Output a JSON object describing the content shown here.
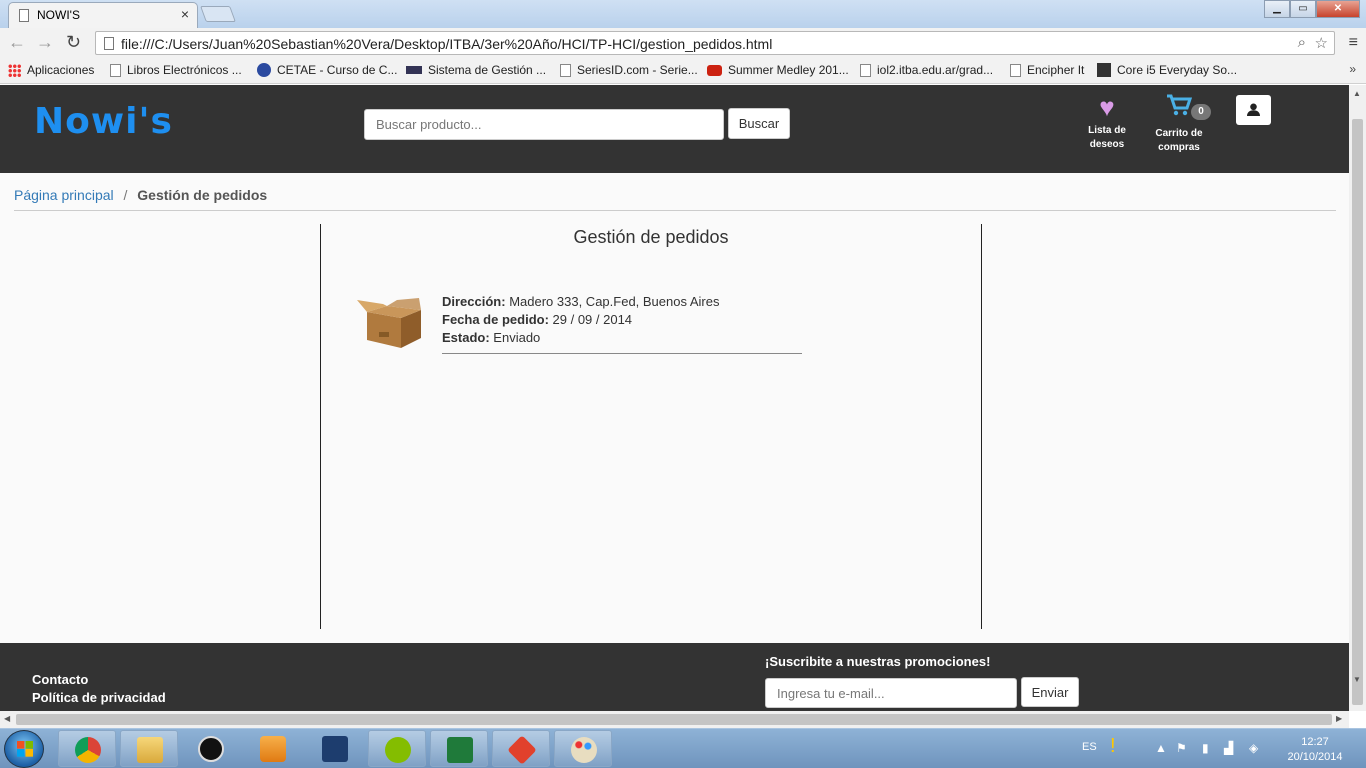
{
  "browser": {
    "tab_title": "NOWI'S",
    "tab_close": "×",
    "url": "file:///C:/Users/Juan%20Sebastian%20Vera/Desktop/ITBA/3er%20Año/HCI/TP-HCI/gestion_pedidos.html",
    "bookmarks": [
      {
        "label": "Aplicaciones",
        "icon": "apps-icon"
      },
      {
        "label": "Libros Electrónicos ...",
        "icon": "page-icon"
      },
      {
        "label": "CETAE - Curso de C...",
        "icon": "cetae-icon"
      },
      {
        "label": "Sistema de Gestión ...",
        "icon": "sistema-icon"
      },
      {
        "label": "SeriesID.com - Serie...",
        "icon": "page-icon"
      },
      {
        "label": "Summer Medley 201...",
        "icon": "youtube-icon"
      },
      {
        "label": "iol2.itba.edu.ar/grad...",
        "icon": "page-icon"
      },
      {
        "label": "Encipher It",
        "icon": "page-icon"
      },
      {
        "label": "Core i5 Everyday So...",
        "icon": "core-icon"
      }
    ],
    "bookmarks_more": "»"
  },
  "site": {
    "logo": "Nowi's",
    "search_placeholder": "Buscar producto...",
    "search_button": "Buscar",
    "wishlist_label": "Lista de deseos",
    "cart_label": "Carrito de compras",
    "cart_count": "0",
    "colors": {
      "header_bg": "#333333",
      "logo": "#1e8ff0",
      "heart": "#d99be6",
      "cart": "#4ab0e6",
      "link": "#337ab7"
    }
  },
  "breadcrumb": {
    "home": "Página principal",
    "separator": "/",
    "current": "Gestión de pedidos"
  },
  "main": {
    "title": "Gestión de pedidos",
    "orders": [
      {
        "direccion_label": "Dirección:",
        "direccion": "Madero 333, Cap.Fed, Buenos Aires",
        "fecha_label": "Fecha de pedido:",
        "fecha": "29 / 09 / 2014",
        "estado_label": "Estado:",
        "estado": "Enviado"
      }
    ]
  },
  "footer": {
    "contacto": "Contacto",
    "privacidad": "Política de privacidad",
    "subscribe_title": "¡Suscribite a nuestras promociones!",
    "email_placeholder": "Ingresa tu e-mail...",
    "send_button": "Enviar"
  },
  "taskbar": {
    "language": "ES",
    "time": "12:27",
    "date": "20/10/2014",
    "apps": [
      "chrome-icon",
      "file-explorer-icon",
      "hp-icon",
      "media-player-icon",
      "task-app-icon",
      "spotify-icon",
      "excel-icon",
      "git-icon",
      "paint-icon"
    ]
  }
}
